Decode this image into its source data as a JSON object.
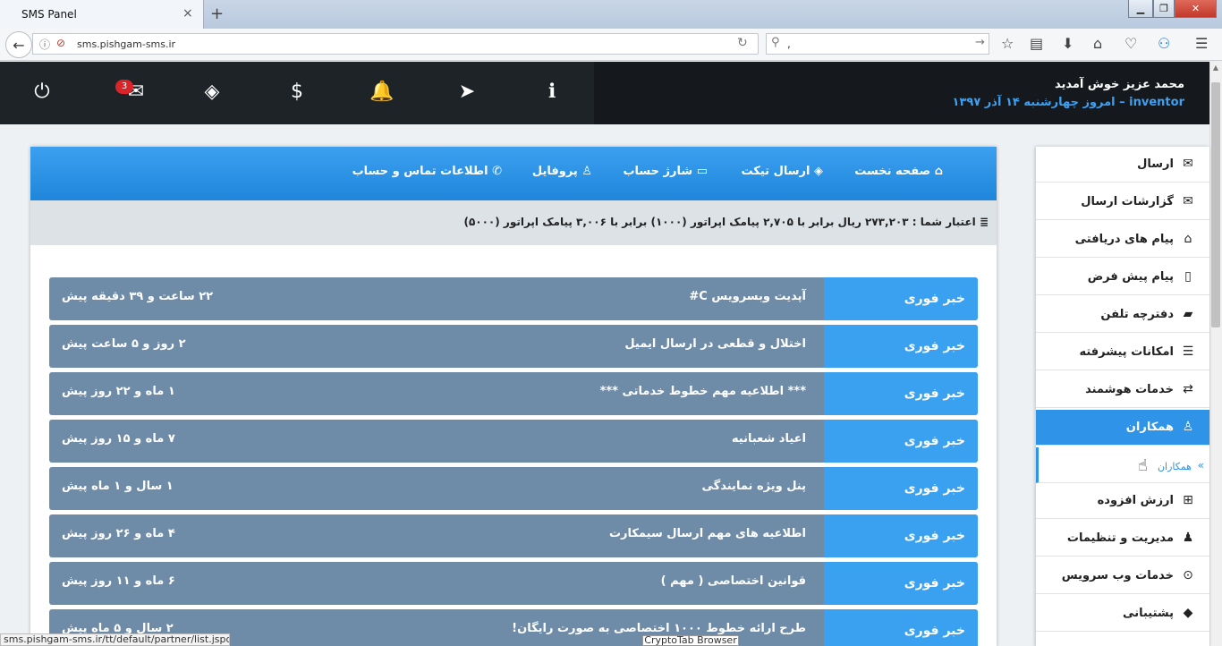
{
  "browser": {
    "tab_title": "SMS Panel",
    "tab_close": "×",
    "new_tab": "+",
    "url": "sms.pishgam-sms.ir",
    "search_value": ",",
    "status_url": "sms.pishgam-sms.ir/tt/default/partner/list.jspd",
    "tooltip": "CryptoTab Browser"
  },
  "header": {
    "welcome": "محمد عزیز خوش آمدید",
    "today_prefix": "inventor",
    "today_text": " – امروز چهارشنبه ۱۴ آذر ۱۳۹۷",
    "mail_count": "3"
  },
  "nav": {
    "home": "صفحه نخست",
    "ticket": "ارسال تیکت",
    "charge": "شارژ حساب",
    "profile": "پروفایل",
    "contact": "اطلاعات تماس و حساب"
  },
  "credit": "اعتبار شما : ۲۷۳,۲۰۳ ریال برابر با ۲,۷۰۵ پیامک اپراتور (۱۰۰۰) برابر با ۳,۰۰۶ پیامک اپراتور (۵۰۰۰)",
  "news": [
    {
      "category": "خبر فوری",
      "title": "آپدیت وبسرویس C#",
      "time": "۲۲ ساعت و ۳۹ دقیقه پیش"
    },
    {
      "category": "خبر فوری",
      "title": "اختلال و قطعی در ارسال ایمیل",
      "time": "۲ روز و ۵ ساعت پیش"
    },
    {
      "category": "خبر فوری",
      "title": "*** اطلاعیه مهم خطوط خدماتی ***",
      "time": "۱ ماه و ۲۲ روز پیش"
    },
    {
      "category": "خبر فوری",
      "title": "اعیاد شعبانیه",
      "time": "۷ ماه و ۱۵ روز پیش"
    },
    {
      "category": "خبر فوری",
      "title": "پنل ویژه نمایندگی",
      "time": "۱ سال و ۱ ماه پیش"
    },
    {
      "category": "خبر فوری",
      "title": "اطلاعیه های مهم ارسال سیمکارت",
      "time": "۴ ماه و ۲۶ روز پیش"
    },
    {
      "category": "خبر فوری",
      "title": "قوانین اختصاصی ( مهم )",
      "time": "۶ ماه و ۱۱ روز پیش"
    },
    {
      "category": "خبر فوری",
      "title": "طرح ارائه خطوط ۱۰۰۰ اختصاصی به صورت رایگان!",
      "time": "۲ سال و ۵ ماه پیش"
    }
  ],
  "sidebar": {
    "items": [
      {
        "label": "ارسال",
        "icon": "✉"
      },
      {
        "label": "گزارشات ارسال",
        "icon": "✉"
      },
      {
        "label": "پیام های دریافتی",
        "icon": "⌂"
      },
      {
        "label": "پیام پیش فرض",
        "icon": "▯"
      },
      {
        "label": "دفترچه تلفن",
        "icon": "▰"
      },
      {
        "label": "امکانات پیشرفته",
        "icon": "☰"
      },
      {
        "label": "خدمات هوشمند",
        "icon": "⇄"
      },
      {
        "label": "همکاران",
        "icon": "♙"
      },
      {
        "label": "ارزش افزوده",
        "icon": "⊞"
      },
      {
        "label": "مدیریت و تنظیمات",
        "icon": "♟"
      },
      {
        "label": "خدمات وب سرویس",
        "icon": "⊙"
      },
      {
        "label": "پشتیبانی",
        "icon": "◆"
      }
    ],
    "sub_item": "همکاران"
  }
}
